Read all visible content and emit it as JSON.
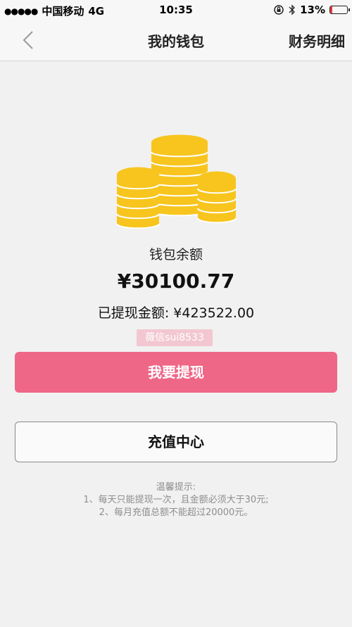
{
  "status_bar": {
    "signal": "●●●●●",
    "carrier": "中国移动",
    "network": "4G",
    "time": "10:35",
    "battery_percent": "13%",
    "battery_level": 0.13,
    "battery_color": "#e23c3c"
  },
  "nav": {
    "title": "我的钱包",
    "right_action": "财务明细"
  },
  "wallet": {
    "balance_label": "钱包余额",
    "balance_amount": "¥30100.77",
    "withdrawn_label": "已提现金额:",
    "withdrawn_amount": "¥423522.00",
    "watermark": "薇信sui8533"
  },
  "buttons": {
    "withdraw": "我要提现",
    "recharge": "充值中心"
  },
  "tips": {
    "title": "温馨提示:",
    "line1": "1、每天只能提现一次，且金额必须大于30元;",
    "line2": "2、每月充值总额不能超过20000元。"
  },
  "colors": {
    "primary": "#ee6787",
    "background": "#f1f1f1",
    "coin": "#f7c51e"
  }
}
